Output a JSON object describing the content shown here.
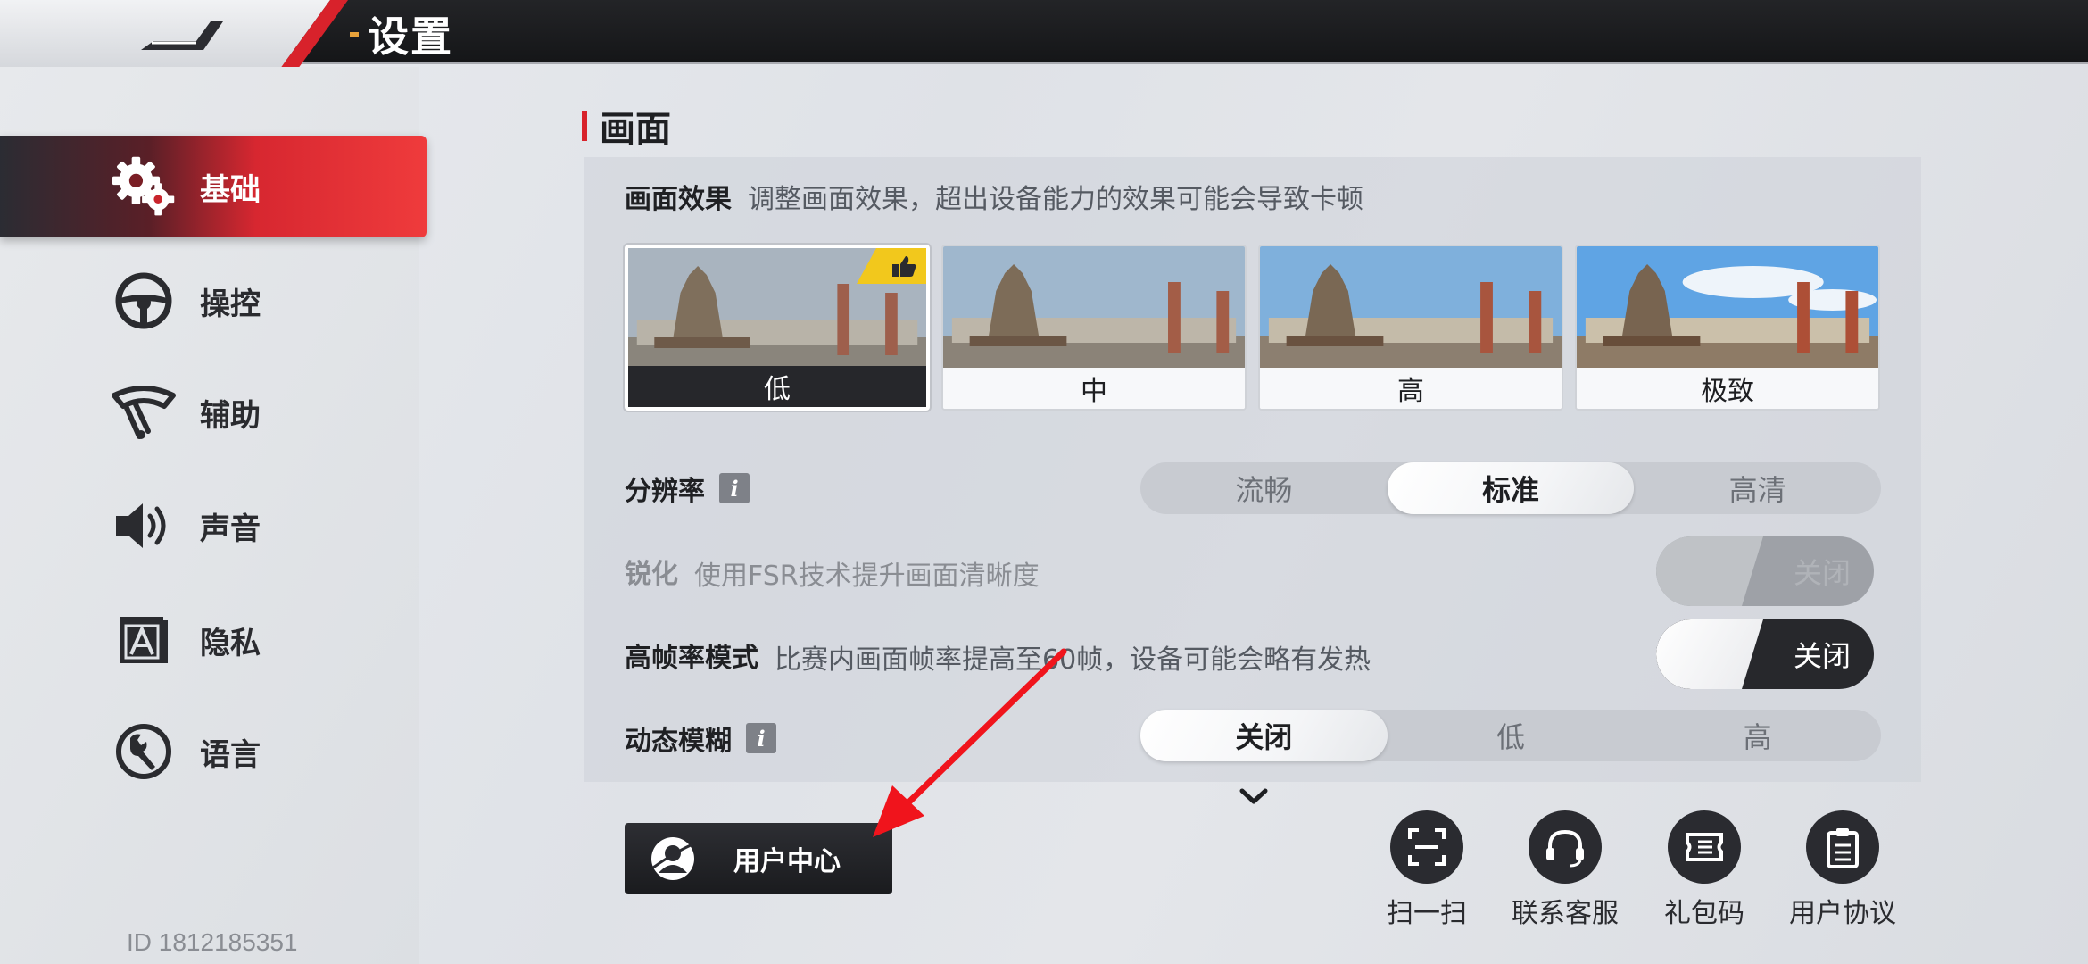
{
  "header": {
    "title": "设置"
  },
  "sidebar": {
    "items": [
      {
        "label": "基础",
        "icon": "gears-icon",
        "active": true
      },
      {
        "label": "操控",
        "icon": "steering-wheel-icon",
        "active": false
      },
      {
        "label": "辅助",
        "icon": "wiper-icon",
        "active": false
      },
      {
        "label": "声音",
        "icon": "speaker-icon",
        "active": false
      },
      {
        "label": "隐私",
        "icon": "privacy-a-icon",
        "active": false
      },
      {
        "label": "语言",
        "icon": "wrench-circle-icon",
        "active": false
      }
    ],
    "user_id": "ID 1812185351"
  },
  "section": {
    "title": "画面"
  },
  "effect": {
    "title": "画面效果",
    "desc": "调整画面效果，超出设备能力的效果可能会导致卡顿",
    "options": [
      "低",
      "中",
      "高",
      "极致"
    ],
    "selected": "低",
    "recommended": "低"
  },
  "resolution": {
    "label": "分辨率",
    "options": [
      "流畅",
      "标准",
      "高清"
    ],
    "selected": "标准"
  },
  "sharpen": {
    "label": "锐化",
    "desc": "使用FSR技术提升画面清晰度",
    "state": "关闭",
    "enabled": false
  },
  "hfr": {
    "label": "高帧率模式",
    "desc": "比赛内画面帧率提高至60帧，设备可能会略有发热",
    "state": "关闭",
    "enabled": true
  },
  "motion_blur": {
    "label": "动态模糊",
    "options": [
      "关闭",
      "低",
      "高"
    ],
    "selected": "关闭"
  },
  "bottom": {
    "user_center": "用户中心",
    "actions": [
      {
        "label": "扫一扫",
        "icon": "scan-icon"
      },
      {
        "label": "联系客服",
        "icon": "headset-icon"
      },
      {
        "label": "礼包码",
        "icon": "gift-code-icon"
      },
      {
        "label": "用户协议",
        "icon": "clipboard-icon"
      }
    ]
  },
  "colors": {
    "accent_red": "#d8222b",
    "dark": "#26272b",
    "badge_yellow": "#f2c81c"
  }
}
